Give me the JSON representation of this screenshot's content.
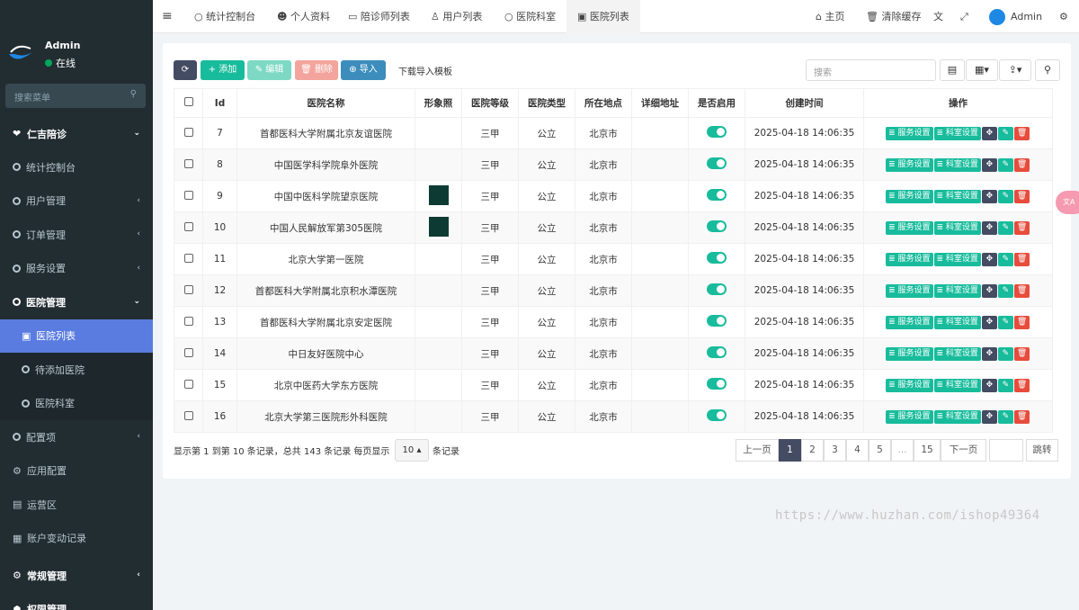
{
  "sidebar": {
    "user": {
      "name": "Admin",
      "status": "在线"
    },
    "search_placeholder": "搜索菜单",
    "items": [
      {
        "label": "仁吉陪诊",
        "icon": "heart-icon",
        "type": "head",
        "arrow": "⌄"
      },
      {
        "label": "统计控制台",
        "type": "sub"
      },
      {
        "label": "用户管理",
        "type": "sub",
        "arrow": "‹"
      },
      {
        "label": "订单管理",
        "type": "sub",
        "arrow": "‹"
      },
      {
        "label": "服务设置",
        "type": "sub",
        "arrow": "‹"
      },
      {
        "label": "医院管理",
        "type": "subhead",
        "arrow": "⌄"
      },
      {
        "label": "医院列表",
        "type": "active"
      },
      {
        "label": "待添加医院",
        "type": "subsub"
      },
      {
        "label": "医院科室",
        "type": "subsub"
      },
      {
        "label": "配置项",
        "type": "sub",
        "arrow": "‹"
      },
      {
        "label": "应用配置",
        "type": "sub"
      },
      {
        "label": "运营区",
        "type": "sub"
      },
      {
        "label": "账户变动记录",
        "type": "sub"
      },
      {
        "label": "常规管理",
        "type": "head2",
        "arrow": "‹"
      },
      {
        "label": "权限管理",
        "type": "head2"
      }
    ]
  },
  "topbar": {
    "tabs": [
      {
        "label": "统计控制台"
      },
      {
        "label": "个人资料"
      },
      {
        "label": "陪诊师列表"
      },
      {
        "label": "用户列表"
      },
      {
        "label": "医院科室"
      },
      {
        "label": "医院列表"
      }
    ],
    "home": "主页",
    "clear_cache": "清除缓存",
    "admin": "Admin"
  },
  "toolbar": {
    "add": "添加",
    "edit": "编辑",
    "delete": "删除",
    "import": "导入",
    "template": "下载导入模板",
    "search_placeholder": "搜索"
  },
  "table": {
    "headers": [
      "Id",
      "医院名称",
      "形象照",
      "医院等级",
      "医院类型",
      "所在地点",
      "详细地址",
      "是否启用",
      "创建时间",
      "操作"
    ],
    "rows": [
      {
        "id": "7",
        "name": "首都医科大学附属北京友谊医院",
        "thumb": false,
        "level": "三甲",
        "type": "公立",
        "location": "北京市",
        "created": "2025-04-18 14:06:35"
      },
      {
        "id": "8",
        "name": "中国医学科学院阜外医院",
        "thumb": false,
        "level": "三甲",
        "type": "公立",
        "location": "北京市",
        "created": "2025-04-18 14:06:35"
      },
      {
        "id": "9",
        "name": "中国中医科学院望京医院",
        "thumb": true,
        "level": "三甲",
        "type": "公立",
        "location": "北京市",
        "created": "2025-04-18 14:06:35"
      },
      {
        "id": "10",
        "name": "中国人民解放军第305医院",
        "thumb": true,
        "level": "三甲",
        "type": "公立",
        "location": "北京市",
        "created": "2025-04-18 14:06:35"
      },
      {
        "id": "11",
        "name": "北京大学第一医院",
        "thumb": false,
        "level": "三甲",
        "type": "公立",
        "location": "北京市",
        "created": "2025-04-18 14:06:35"
      },
      {
        "id": "12",
        "name": "首都医科大学附属北京积水潭医院",
        "thumb": false,
        "level": "三甲",
        "type": "公立",
        "location": "北京市",
        "created": "2025-04-18 14:06:35"
      },
      {
        "id": "13",
        "name": "首都医科大学附属北京安定医院",
        "thumb": false,
        "level": "三甲",
        "type": "公立",
        "location": "北京市",
        "created": "2025-04-18 14:06:35"
      },
      {
        "id": "14",
        "name": "中日友好医院中心",
        "thumb": false,
        "level": "三甲",
        "type": "公立",
        "location": "北京市",
        "created": "2025-04-18 14:06:35"
      },
      {
        "id": "15",
        "name": "北京中医药大学东方医院",
        "thumb": false,
        "level": "三甲",
        "type": "公立",
        "location": "北京市",
        "created": "2025-04-18 14:06:35"
      },
      {
        "id": "16",
        "name": "北京大学第三医院形外科医院",
        "thumb": false,
        "level": "三甲",
        "type": "公立",
        "location": "北京市",
        "created": "2025-04-18 14:06:35"
      }
    ],
    "op_service": "服务设置",
    "op_dept": "科室设置"
  },
  "footer": {
    "summary": "显示第 1 到第 10 条记录，总共 143 条记录 每页显示",
    "page_size": "10",
    "records_suffix": "条记录"
  },
  "pagination": {
    "prev": "上一页",
    "pages": [
      "1",
      "2",
      "3",
      "4",
      "5",
      "...",
      "15"
    ],
    "next": "下一页",
    "jump": "跳转"
  },
  "watermark": "https://www.huzhan.com/ishop49364"
}
